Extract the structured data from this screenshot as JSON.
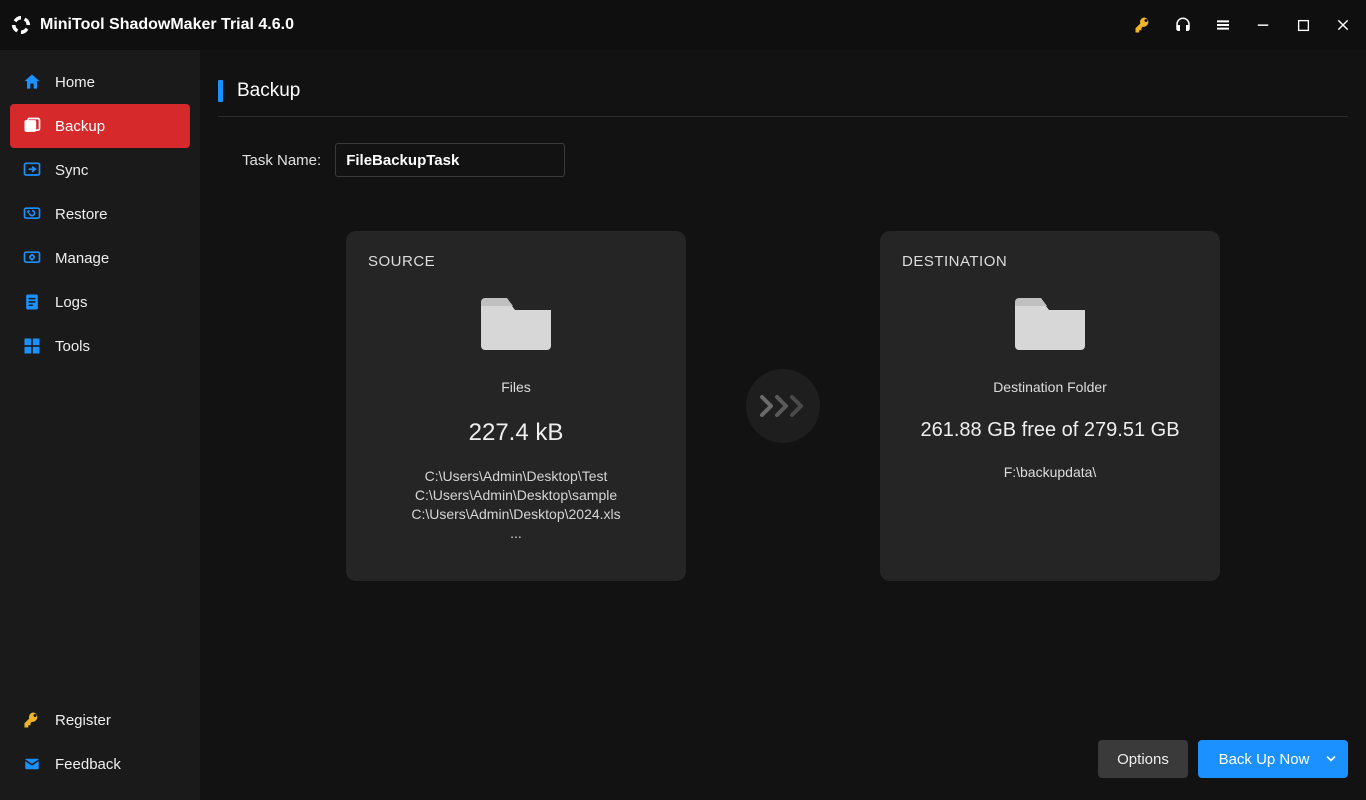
{
  "window": {
    "title": "MiniTool ShadowMaker Trial 4.6.0"
  },
  "titlebar_icons": {
    "key": "key-icon",
    "support": "headset-icon",
    "menu": "menu-icon",
    "minimize": "minimize-icon",
    "maximize": "maximize-icon",
    "close": "close-icon"
  },
  "sidebar": {
    "items": [
      {
        "id": "home",
        "label": "Home",
        "active": false
      },
      {
        "id": "backup",
        "label": "Backup",
        "active": true
      },
      {
        "id": "sync",
        "label": "Sync",
        "active": false
      },
      {
        "id": "restore",
        "label": "Restore",
        "active": false
      },
      {
        "id": "manage",
        "label": "Manage",
        "active": false
      },
      {
        "id": "logs",
        "label": "Logs",
        "active": false
      },
      {
        "id": "tools",
        "label": "Tools",
        "active": false
      }
    ],
    "footer": [
      {
        "id": "register",
        "label": "Register"
      },
      {
        "id": "feedback",
        "label": "Feedback"
      }
    ]
  },
  "page": {
    "title": "Backup",
    "task_name_label": "Task Name:",
    "task_name_value": "FileBackupTask"
  },
  "source": {
    "heading": "SOURCE",
    "type_label": "Files",
    "size": "227.4 kB",
    "paths": [
      "C:\\Users\\Admin\\Desktop\\Test",
      "C:\\Users\\Admin\\Desktop\\sample",
      "C:\\Users\\Admin\\Desktop\\2024.xls"
    ],
    "more": "..."
  },
  "destination": {
    "heading": "DESTINATION",
    "type_label": "Destination Folder",
    "free_text": "261.88 GB free of 279.51 GB",
    "path": "F:\\backupdata\\"
  },
  "actions": {
    "options": "Options",
    "backup_now": "Back Up Now"
  },
  "colors": {
    "accent_blue": "#1b90ff",
    "accent_red": "#d6292b",
    "key_gold": "#f0b428"
  }
}
